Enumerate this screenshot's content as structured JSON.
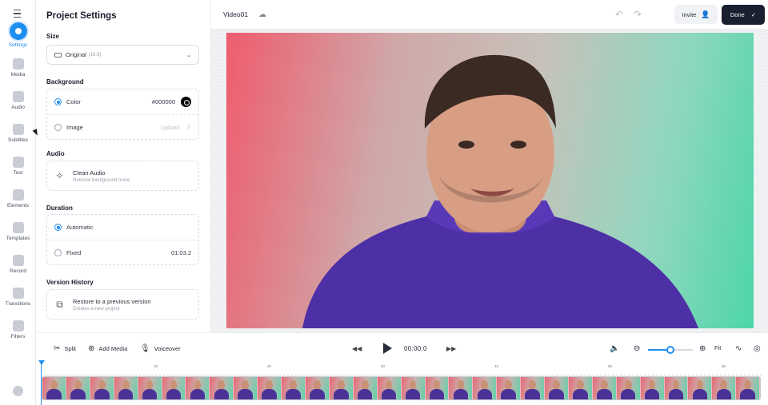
{
  "sidebar": {
    "items": [
      {
        "label": "Settings",
        "icon": "settings-icon",
        "active": true
      },
      {
        "label": "Media",
        "icon": "media-icon"
      },
      {
        "label": "Audio",
        "icon": "audio-icon"
      },
      {
        "label": "Subtitles",
        "icon": "subtitles-icon"
      },
      {
        "label": "Text",
        "icon": "text-icon"
      },
      {
        "label": "Elements",
        "icon": "elements-icon"
      },
      {
        "label": "Templates",
        "icon": "templates-icon"
      },
      {
        "label": "Record",
        "icon": "record-icon"
      },
      {
        "label": "Transitions",
        "icon": "transitions-icon"
      },
      {
        "label": "Filters",
        "icon": "filters-icon"
      }
    ]
  },
  "panel": {
    "title": "Project Settings",
    "size": {
      "heading": "Size",
      "value": "Original",
      "sub": "(16:9)"
    },
    "background": {
      "heading": "Background",
      "color_label": "Color",
      "color_value": "#000000",
      "image_label": "Image",
      "upload_label": "Upload"
    },
    "audio": {
      "heading": "Audio",
      "title": "Clean Audio",
      "sub": "Remove background noise"
    },
    "duration": {
      "heading": "Duration",
      "automatic": "Automatic",
      "fixed": "Fixed",
      "fixed_value": "01:03.2"
    },
    "version": {
      "heading": "Version History",
      "title": "Restore to a previous version",
      "sub": "Creates a new project"
    }
  },
  "topbar": {
    "title": "Video01",
    "invite_label": "Invite",
    "done_label": "Done"
  },
  "controls": {
    "split": "Split",
    "add_media": "Add Media",
    "voiceover": "Voiceover",
    "time": "00:00:0",
    "fit": "Fit",
    "zoom_level": 0.5
  },
  "timeline": {
    "ticks": [
      "10",
      "20",
      "30",
      "40",
      "50",
      "60"
    ],
    "frame_count": 30
  },
  "colors": {
    "accent": "#1f8ef1",
    "done_bg": "#1b2030"
  }
}
